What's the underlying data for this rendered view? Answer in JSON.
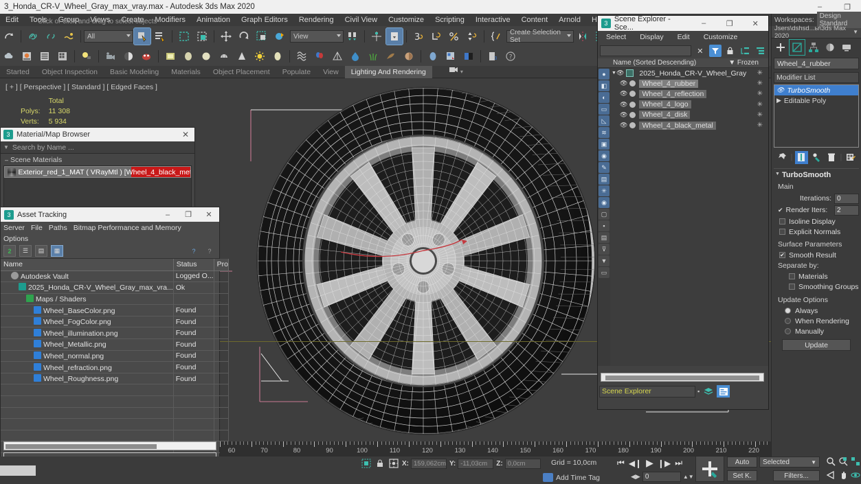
{
  "titlebar": {
    "title": "3_Honda_CR-V_Wheel_Gray_max_vray.max - Autodesk 3ds Max 2020",
    "minimize": "–",
    "maximize": "❐",
    "close": "✕"
  },
  "menubar": {
    "items": [
      "Edit",
      "Tools",
      "Group",
      "Views",
      "Create",
      "Modifiers",
      "Animation",
      "Graph Editors",
      "Rendering",
      "Civil View",
      "Customize",
      "Scripting",
      "Interactive",
      "Content",
      "Arnold",
      "Help"
    ]
  },
  "toolbar": {
    "selection_filter": "All",
    "reference_coord": "View",
    "selection_set": "Create Selection Set"
  },
  "ribbon": {
    "tabs": [
      "Started",
      "Object Inspection",
      "Basic Modeling",
      "Materials",
      "Object Placement",
      "Populate",
      "View",
      "Lighting And Rendering"
    ],
    "active": "Lighting And Rendering"
  },
  "viewport": {
    "label": "[ + ] [ Perspective ] [ Standard ] [ Edged Faces ]",
    "stats_header": "Total",
    "stats": [
      {
        "label": "Polys:",
        "value": "11 308"
      },
      {
        "label": "Verts:",
        "value": "5 934"
      }
    ]
  },
  "material_browser": {
    "title": "Material/Map Browser",
    "close": "✕",
    "search_placeholder": "Search by Name ...",
    "section": "Scene Materials",
    "items": [
      {
        "name": "Exterior_red_1_MAT   ( VRayMtl )   [Wheel_4_black_met..."
      }
    ]
  },
  "asset_tracking": {
    "title": "Asset Tracking",
    "icon_label": "3",
    "minimize": "–",
    "maximize": "❐",
    "close": "✕",
    "menu_row1": [
      "Server",
      "File",
      "Paths",
      "Bitmap Performance and Memory"
    ],
    "menu_row2": [
      "Options"
    ],
    "columns": [
      "Name",
      "Status",
      "Pro"
    ],
    "rows": [
      {
        "indent": 1,
        "icon": "vault",
        "name": "Autodesk Vault",
        "status": "Logged O..."
      },
      {
        "indent": 2,
        "icon": "max",
        "name": "2025_Honda_CR-V_Wheel_Gray_max_vra...",
        "status": "Ok"
      },
      {
        "indent": 3,
        "icon": "maps",
        "name": "Maps / Shaders",
        "status": ""
      },
      {
        "indent": 4,
        "icon": "png",
        "name": "Wheel_BaseColor.png",
        "status": "Found"
      },
      {
        "indent": 4,
        "icon": "png",
        "name": "Wheel_FogColor.png",
        "status": "Found"
      },
      {
        "indent": 4,
        "icon": "png",
        "name": "Wheel_illumination.png",
        "status": "Found"
      },
      {
        "indent": 4,
        "icon": "png",
        "name": "Wheel_Metallic.png",
        "status": "Found"
      },
      {
        "indent": 4,
        "icon": "png",
        "name": "Wheel_normal.png",
        "status": "Found"
      },
      {
        "indent": 4,
        "icon": "png",
        "name": "Wheel_refraction.png",
        "status": "Found"
      },
      {
        "indent": 4,
        "icon": "png",
        "name": "Wheel_Roughness.png",
        "status": "Found"
      },
      {
        "indent": 0,
        "icon": "",
        "name": "",
        "status": ""
      },
      {
        "indent": 0,
        "icon": "",
        "name": "",
        "status": ""
      },
      {
        "indent": 0,
        "icon": "",
        "name": "",
        "status": ""
      },
      {
        "indent": 0,
        "icon": "",
        "name": "",
        "status": ""
      },
      {
        "indent": 0,
        "icon": "",
        "name": "",
        "status": ""
      },
      {
        "indent": 0,
        "icon": "",
        "name": "",
        "status": ""
      }
    ]
  },
  "scene_explorer": {
    "title": "Scene Explorer - Sce...",
    "icon_label": "3",
    "minimize": "–",
    "maximize": "❐",
    "close": "✕",
    "menu": [
      "Select",
      "Display",
      "Edit",
      "Customize"
    ],
    "search_value": "",
    "col_name": "Name (Sorted Descending)",
    "col_frozen": "Frozen",
    "rows": [
      {
        "level": 0,
        "name": "2025_Honda_CR-V_Wheel_Gray",
        "selected": false
      },
      {
        "level": 1,
        "name": "Wheel_4_rubber",
        "selected": true
      },
      {
        "level": 1,
        "name": "Wheel_4_reflection",
        "selected": false
      },
      {
        "level": 1,
        "name": "Wheel_4_logo",
        "selected": false
      },
      {
        "level": 1,
        "name": "Wheel_4_disk",
        "selected": false
      },
      {
        "level": 1,
        "name": "Wheel_4_black_metal",
        "selected": false
      }
    ],
    "footer_value": "Scene Explorer"
  },
  "command_panel": {
    "workspaces_label": "Workspaces:",
    "workspace_value": "Design Standard",
    "path": "Jsers\\dshsd...ы\\3ds Max 2020",
    "object_name": "Wheel_4_rubber",
    "modifier_list_label": "Modifier List",
    "stack": [
      {
        "name": "TurboSmooth",
        "active": true
      },
      {
        "name": "Editable Poly",
        "active": false
      }
    ],
    "rollout_title": "TurboSmooth",
    "main_label": "Main",
    "iterations_label": "Iterations:",
    "iterations_value": "0",
    "render_iters_label": "Render Iters:",
    "render_iters_value": "2",
    "isoline_label": "Isoline Display",
    "explicit_label": "Explicit Normals",
    "surface_params_label": "Surface Parameters",
    "smooth_result_label": "Smooth Result",
    "separate_by_label": "Separate by:",
    "materials_label": "Materials",
    "smoothing_groups_label": "Smoothing Groups",
    "update_options_label": "Update Options",
    "update_modes": [
      "Always",
      "When Rendering",
      "Manually"
    ],
    "update_selected": "Always",
    "update_button": "Update"
  },
  "timeline": {
    "labels": [
      "60",
      "70",
      "80",
      "90",
      "100",
      "110",
      "120",
      "130",
      "140",
      "150",
      "160",
      "170",
      "180",
      "190",
      "200",
      "210",
      "220"
    ]
  },
  "status_bar": {
    "prompt": "Click or click-and-drag to select objects",
    "x_label": "X:",
    "x_value": "159,062cm",
    "y_label": "Y:",
    "y_value": "-11,03cm",
    "z_label": "Z:",
    "z_value": "0,0cm",
    "grid": "Grid = 10,0cm",
    "add_time_tag": "Add Time Tag",
    "frame_value": "0",
    "auto_key": "Auto",
    "set_key": "Set K.",
    "key_filter": "Selected",
    "filters": "Filters..."
  },
  "colors": {
    "accent": "#4b8fd4",
    "teal": "#2ba99b",
    "stats_yellow": "#d9d96a",
    "highlight_red": "#c81818"
  }
}
